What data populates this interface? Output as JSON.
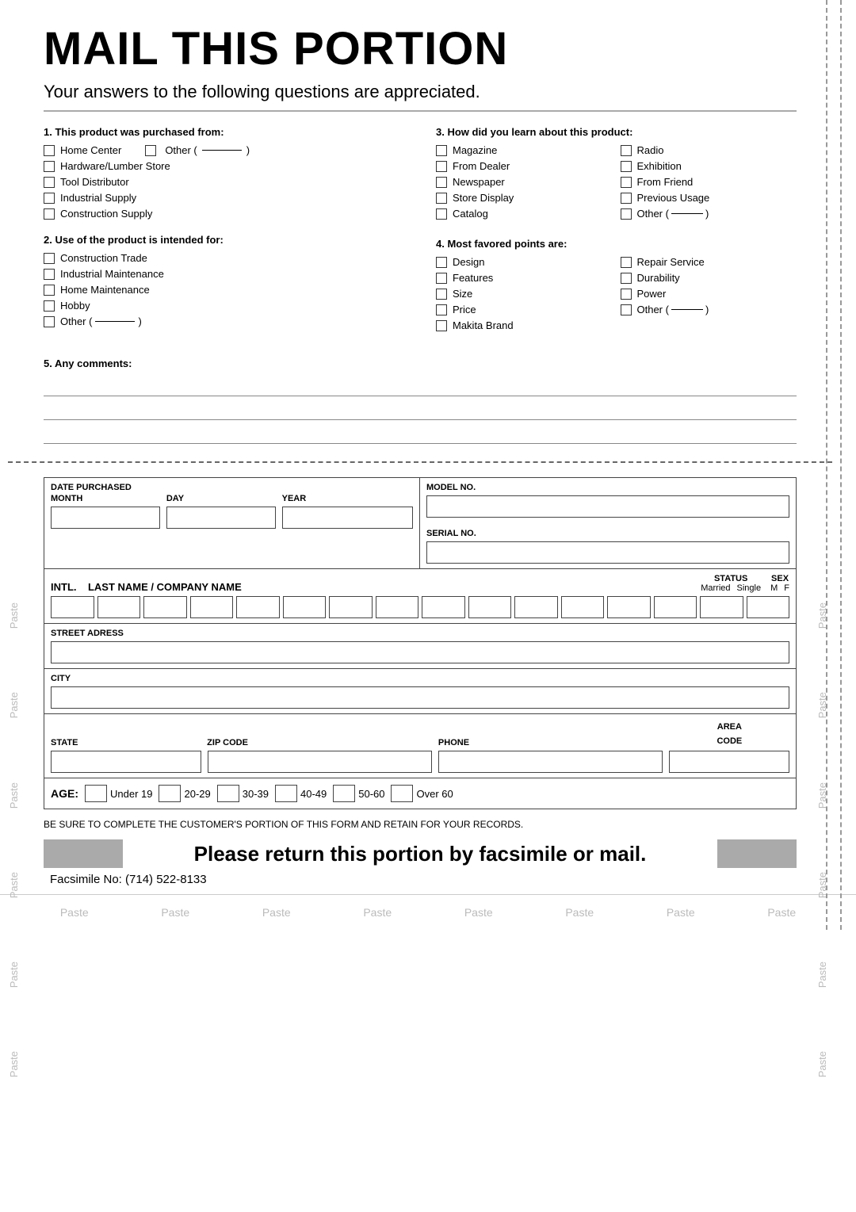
{
  "title": "MAIL THIS PORTION",
  "subtitle": "Your answers to the following questions are appreciated.",
  "q1": {
    "title": "1. This product was purchased from:",
    "options": [
      "Home Center",
      "Hardware/Lumber Store",
      "Tool Distributor",
      "Industrial Supply",
      "Construction Supply"
    ],
    "other_label": "Other (",
    "other_close": ")"
  },
  "q2": {
    "title": "2. Use of the product is intended for:",
    "options": [
      "Construction Trade",
      "Industrial Maintenance",
      "Home Maintenance",
      "Hobby"
    ],
    "other_label": "Other (",
    "other_close": ")"
  },
  "q3": {
    "title": "3. How did you learn about this product:",
    "col1": [
      "Magazine",
      "From Dealer",
      "Newspaper",
      "Store Display",
      "Catalog"
    ],
    "col2": [
      "Radio",
      "Exhibition",
      "From Friend",
      "Previous Usage"
    ],
    "other_label": "Other (",
    "other_close": ")"
  },
  "q4": {
    "title": "4. Most favored points are:",
    "col1": [
      "Design",
      "Features",
      "Size",
      "Price",
      "Makita Brand"
    ],
    "col2": [
      "Repair Service",
      "Durability",
      "Power"
    ],
    "other_label": "Other (",
    "other_close": ")"
  },
  "q5": {
    "title": "5. Any comments:"
  },
  "form": {
    "date_purchased_label": "DATE PURCHASED",
    "month_label": "MONTH",
    "day_label": "DAY",
    "year_label": "YEAR",
    "model_no_label": "MODEL NO.",
    "serial_no_label": "SERIAL NO.",
    "intl_label": "INTL.",
    "name_label": "LAST NAME / COMPANY NAME",
    "status_label": "STATUS",
    "married_label": "Married",
    "single_label": "Single",
    "sex_label": "SEX",
    "m_label": "M",
    "f_label": "F",
    "street_label": "STREET ADRESS",
    "city_label": "CITY",
    "state_label": "STATE",
    "zip_label": "ZIP CODE",
    "phone_label": "PHONE",
    "area_label": "AREA CODE",
    "age_label": "AGE:",
    "age_groups": [
      "Under 19",
      "20-29",
      "30-39",
      "40-49",
      "50-60",
      "Over 60"
    ],
    "notice": "BE SURE TO COMPLETE THE CUSTOMER'S PORTION OF THIS FORM AND RETAIN FOR YOUR RECORDS.",
    "return_text": "Please return this portion by facsimile or mail.",
    "fax_label": "Facsimile No: (714) 522-8133"
  },
  "paste_labels": [
    "Paste",
    "Paste",
    "Paste",
    "Paste",
    "Paste",
    "Paste",
    "Paste",
    "Paste"
  ],
  "side_paste_labels": [
    "Paste",
    "Paste",
    "Paste",
    "Paste",
    "Paste",
    "Paste"
  ]
}
